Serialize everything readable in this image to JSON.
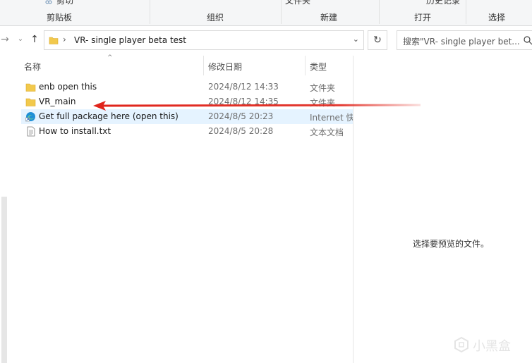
{
  "ribbon": {
    "partial_top": {
      "cut": "剪切",
      "new_item": "文件夹",
      "history": "历史记录"
    },
    "groups": {
      "clipboard": "剪贴板",
      "organize": "组织",
      "new": "新建",
      "open": "打开",
      "select": "选择"
    }
  },
  "address_bar": {
    "path": "VR- single player beta test",
    "search_placeholder": "搜索\"VR- single player bet..."
  },
  "columns": {
    "name": "名称",
    "modified": "修改日期",
    "type": "类型"
  },
  "files": [
    {
      "name": "enb open this",
      "modified": "2024/8/12 14:33",
      "type": "文件夹",
      "icon": "folder-icon",
      "selected": false
    },
    {
      "name": "VR_main",
      "modified": "2024/8/12 14:35",
      "type": "文件夹",
      "icon": "folder-icon",
      "selected": false
    },
    {
      "name": "Get full package here (open this)",
      "modified": "2024/8/5 20:23",
      "type": "Internet 快",
      "icon": "edge-shortcut-icon",
      "selected": true
    },
    {
      "name": "How to install.txt",
      "modified": "2024/8/5 20:28",
      "type": "文本文档",
      "icon": "text-file-icon",
      "selected": false
    }
  ],
  "preview": {
    "message": "选择要预览的文件。"
  },
  "watermark": {
    "text": "小黑盒"
  },
  "colors": {
    "selected_row": "#e5f3ff",
    "annotation_arrow": "#e0241b",
    "folder": "#f2c94c"
  }
}
